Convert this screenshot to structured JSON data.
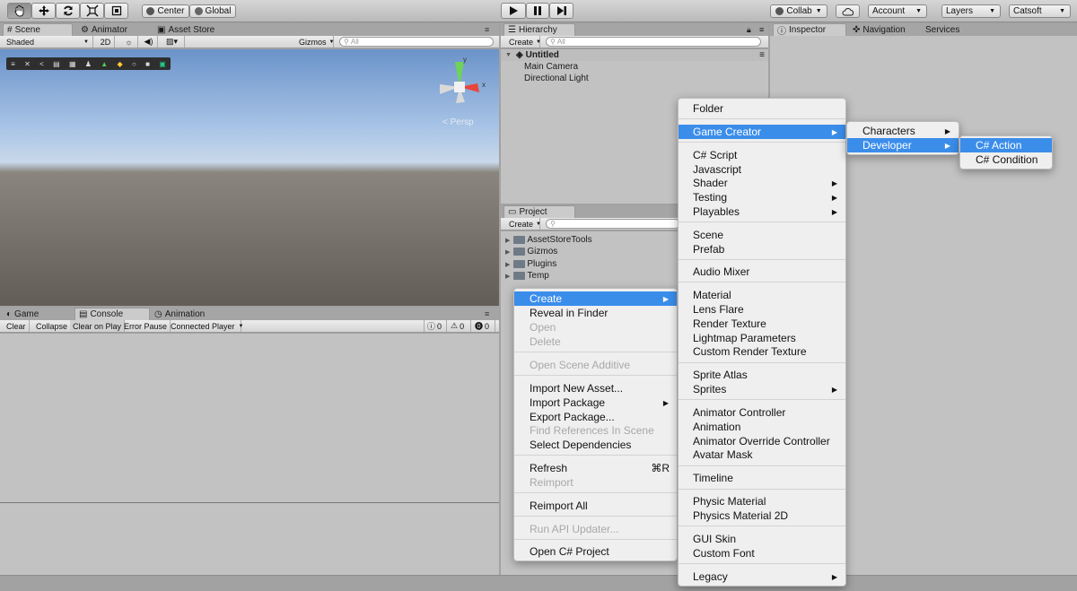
{
  "toolbar": {
    "tools": [
      "hand-icon",
      "move-icon",
      "rotate-icon",
      "scale-icon",
      "rect-tool-icon"
    ],
    "pivot_label": "Center",
    "space_label": "Global",
    "collab_label": "Collab",
    "account_label": "Account",
    "layers_label": "Layers",
    "layout_label": "Catsoft"
  },
  "scene": {
    "tabs": [
      "Scene",
      "Animator",
      "Asset Store"
    ],
    "shading": "Shaded",
    "mode2d": "2D",
    "gizmos": "Gizmos",
    "search_placeholder": "All",
    "persp": "Persp",
    "axis_y": "y",
    "axis_x": "x"
  },
  "console": {
    "tabs": [
      "Game",
      "Console",
      "Animation"
    ],
    "buttons": [
      "Clear",
      "Collapse",
      "Clear on Play",
      "Error Pause",
      "Connected Player"
    ],
    "counts": [
      "0",
      "0",
      "0"
    ]
  },
  "hierarchy": {
    "tab": "Hierarchy",
    "create": "Create",
    "search_placeholder": "All",
    "scene_name": "Untitled",
    "items": [
      "Main Camera",
      "Directional Light"
    ]
  },
  "project": {
    "tab": "Project",
    "create": "Create",
    "folders": [
      "AssetStoreTools",
      "Gizmos",
      "Plugins",
      "Temp"
    ]
  },
  "inspector": {
    "tabs": [
      "Inspector",
      "Navigation",
      "Services"
    ]
  },
  "context_menu": {
    "create": "Create",
    "reveal": "Reveal in Finder",
    "open": "Open",
    "delete": "Delete",
    "open_additive": "Open Scene Additive",
    "import_new": "Import New Asset...",
    "import_package": "Import Package",
    "export_package": "Export Package...",
    "find_refs": "Find References In Scene",
    "select_deps": "Select Dependencies",
    "refresh": "Refresh",
    "refresh_shortcut": "⌘R",
    "reimport": "Reimport",
    "reimport_all": "Reimport All",
    "run_api": "Run API Updater...",
    "open_csharp": "Open C# Project"
  },
  "create_menu": {
    "folder": "Folder",
    "game_creator": "Game Creator",
    "csharp_script": "C# Script",
    "javascript": "Javascript",
    "shader": "Shader",
    "testing": "Testing",
    "playables": "Playables",
    "scene": "Scene",
    "prefab": "Prefab",
    "audio_mixer": "Audio Mixer",
    "material": "Material",
    "lens_flare": "Lens Flare",
    "render_texture": "Render Texture",
    "lightmap_params": "Lightmap Parameters",
    "custom_render_texture": "Custom Render Texture",
    "sprite_atlas": "Sprite Atlas",
    "sprites": "Sprites",
    "animator_controller": "Animator Controller",
    "animation": "Animation",
    "animator_override": "Animator Override Controller",
    "avatar_mask": "Avatar Mask",
    "timeline": "Timeline",
    "physic_material": "Physic Material",
    "physics_material_2d": "Physics Material 2D",
    "gui_skin": "GUI Skin",
    "custom_font": "Custom Font",
    "legacy": "Legacy"
  },
  "game_creator_menu": {
    "characters": "Characters",
    "developer": "Developer"
  },
  "developer_menu": {
    "action": "C# Action",
    "condition": "C# Condition"
  },
  "colors": {
    "highlight": "#3b8dea",
    "menu_bg": "#efefef",
    "sky_top": "#6b93c9",
    "ground": "#625d57"
  }
}
